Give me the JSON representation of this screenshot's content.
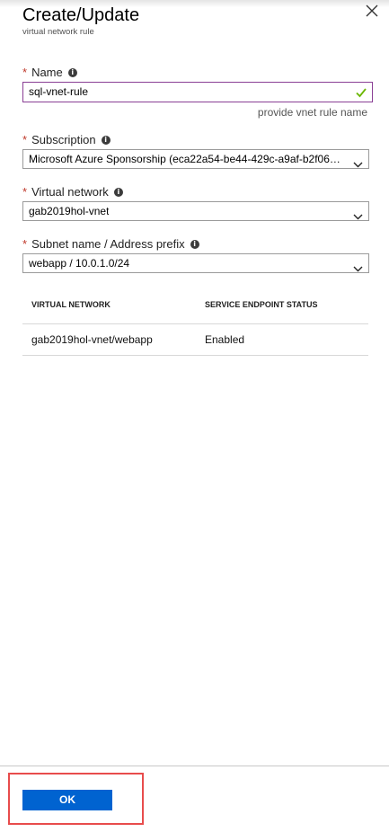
{
  "header": {
    "title": "Create/Update",
    "subtitle": "virtual network rule"
  },
  "form": {
    "name": {
      "label": "Name",
      "value": "sql-vnet-rule",
      "hint": "provide vnet rule name"
    },
    "subscription": {
      "label": "Subscription",
      "value": "Microsoft Azure Sponsorship (eca22a54-be44-429c-a9af-b2f06381..."
    },
    "virtual_network": {
      "label": "Virtual network",
      "value": "gab2019hol-vnet"
    },
    "subnet": {
      "label": "Subnet name / Address prefix",
      "value": "webapp / 10.0.1.0/24"
    }
  },
  "table": {
    "columns": [
      "VIRTUAL NETWORK",
      "SERVICE ENDPOINT STATUS"
    ],
    "rows": [
      [
        "gab2019hol-vnet/webapp",
        "Enabled"
      ]
    ]
  },
  "footer": {
    "ok_label": "OK"
  },
  "colors": {
    "primary_button": "#0063d0",
    "required_asterisk": "#c0392b",
    "valid_check": "#6bb700",
    "highlight_box": "#e84c4c"
  }
}
